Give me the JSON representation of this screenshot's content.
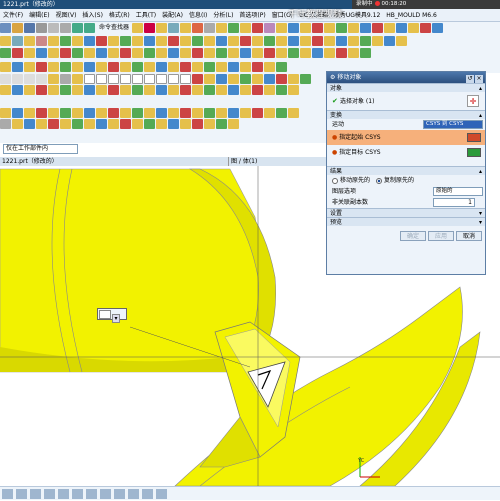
{
  "window": {
    "title": "1221.prt（修改的）",
    "recording": {
      "label": "录制中",
      "time": "00:18:20"
    }
  },
  "menubar": {
    "items": [
      "文件(F)",
      "编辑(E)",
      "视图(V)",
      "插入(S)",
      "格式(R)",
      "工具(T)",
      "装配(A)",
      "信息(I)",
      "分析(L)",
      "首选项(P)",
      "窗口(O)",
      "GC 工具箱",
      "燕秀UG模具9.12",
      "HB_MOULD M6.6"
    ],
    "watermark": "千叶教程视频"
  },
  "toolbar": {
    "command_finder": "命令查找器"
  },
  "selection": {
    "filter_value": "仅在工作部件内"
  },
  "viewport": {
    "title_left": "1221.prt（修改的）",
    "title_right": "图 / 体(1)"
  },
  "wcs": {
    "axis_label": "YC"
  },
  "dialog": {
    "title": "移动对象",
    "sections": {
      "object": "对象",
      "transform": "变换",
      "result": "结果",
      "settings": "设置",
      "preview": "预览"
    },
    "select_object": "选择对象 (1)",
    "motion_label": "运动",
    "motion_value": "CSYS 到 CSYS",
    "from_csys": "指定起始 CSYS",
    "to_csys": "指定目标 CSYS",
    "move_original": "移动原先的",
    "copy_original": "复制原先的",
    "layer_option_label": "图层选项",
    "layer_option_value": "原始的",
    "copies_label": "非关联副本数",
    "copies_value": "1",
    "ok": "确定",
    "apply": "应用",
    "cancel": "取消"
  },
  "colors": {
    "model": "#f2f200",
    "model_shadow": "#a8a800",
    "titlebar": "#1f4e79",
    "highlight": "#f6b07b"
  }
}
